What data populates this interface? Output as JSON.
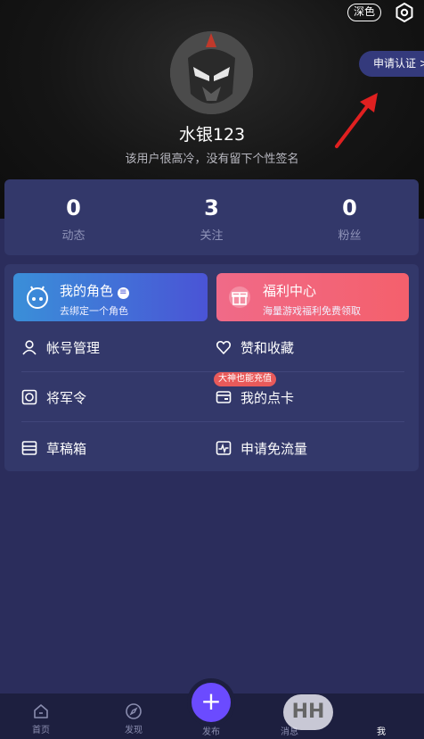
{
  "header": {
    "dark_mode_label": "深色",
    "apply_cert_label": "申请认证 >"
  },
  "profile": {
    "nickname": "水银123",
    "signature": "该用户很高冷，没有留下个性签名"
  },
  "stats": [
    {
      "value": "0",
      "label": "动态"
    },
    {
      "value": "3",
      "label": "关注"
    },
    {
      "value": "0",
      "label": "粉丝"
    }
  ],
  "cards": [
    {
      "title": "我的角色",
      "subtitle": "去绑定一个角色",
      "icon": "gamepad-icon"
    },
    {
      "title": "福利中心",
      "subtitle": "海量游戏福利免费领取",
      "icon": "gift-icon"
    }
  ],
  "menu": {
    "account": "帐号管理",
    "likes": "赞和收藏",
    "general_order": "将军令",
    "my_cards": "我的点卡",
    "my_cards_badge": "大神也能充值",
    "drafts": "草稿箱",
    "free_traffic": "申请免流量"
  },
  "tabbar": {
    "home": "首页",
    "discover": "发现",
    "publish": "发布",
    "messages": "消息",
    "me": "我"
  },
  "watermark": "HH",
  "colors": {
    "accent": "#6b4bff",
    "card_role": "#3f72e0",
    "card_welfare": "#f2607a",
    "badge": "#e85a5a"
  }
}
